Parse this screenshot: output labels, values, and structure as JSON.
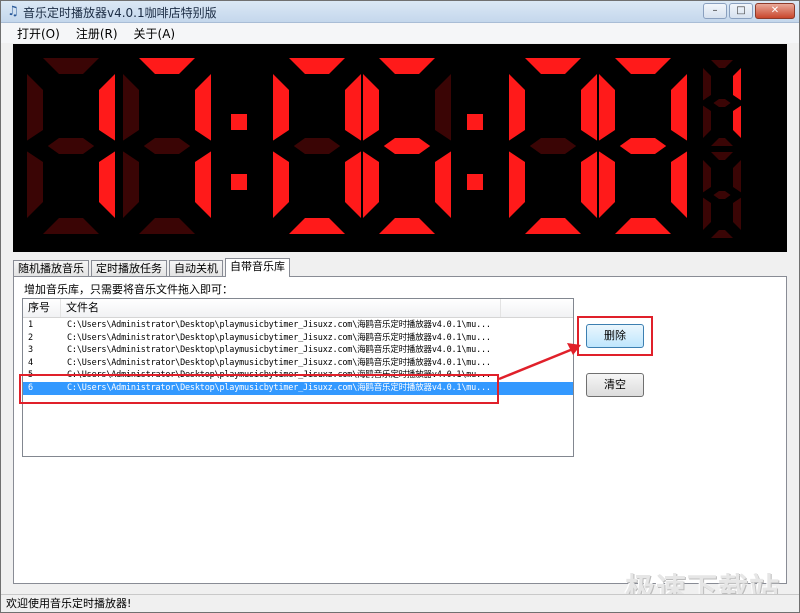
{
  "window": {
    "title": "音乐定时播放器v4.0.1咖啡店特别版",
    "app_icon": "music-note-icon",
    "controls": [
      "minimize-icon",
      "maximize-icon",
      "close-icon"
    ]
  },
  "menu": {
    "items": [
      "打开(O)",
      "注册(R)",
      "关于(A)"
    ]
  },
  "clock": {
    "time": "17:06:08",
    "seconds_small": "1",
    "segment_on_color": "#ff1a1a",
    "segment_off_color": "#3a0505"
  },
  "tabs": [
    {
      "label": "随机播放音乐",
      "active": false
    },
    {
      "label": "定时播放任务",
      "active": false
    },
    {
      "label": "自动关机",
      "active": false
    },
    {
      "label": "自带音乐库",
      "active": true
    }
  ],
  "library": {
    "hint": "增加音乐库，只需要将音乐文件拖入即可：",
    "columns": [
      "序号",
      "文件名"
    ],
    "rows": [
      {
        "index": "1",
        "path": "C:\\Users\\Administrator\\Desktop\\playmusicbytimer_Jisuxz.com\\海鸥音乐定时播放器v4.0.1\\mu..."
      },
      {
        "index": "2",
        "path": "C:\\Users\\Administrator\\Desktop\\playmusicbytimer_Jisuxz.com\\海鸥音乐定时播放器v4.0.1\\mu..."
      },
      {
        "index": "3",
        "path": "C:\\Users\\Administrator\\Desktop\\playmusicbytimer_Jisuxz.com\\海鸥音乐定时播放器v4.0.1\\mu..."
      },
      {
        "index": "4",
        "path": "C:\\Users\\Administrator\\Desktop\\playmusicbytimer_Jisuxz.com\\海鸥音乐定时播放器v4.0.1\\mu..."
      },
      {
        "index": "5",
        "path": "C:\\Users\\Administrator\\Desktop\\playmusicbytimer_Jisuxz.com\\海鸥音乐定时播放器v4.0.1\\mu..."
      },
      {
        "index": "6",
        "path": "C:\\Users\\Administrator\\Desktop\\playmusicbytimer_Jisuxz.com\\海鸥音乐定时播放器v4.0.1\\mu...",
        "selected": true
      }
    ],
    "delete_label": "删除",
    "clear_label": "清空"
  },
  "annotation_color": "#e0202a",
  "watermark": "极速下载站",
  "status": "欢迎使用音乐定时播放器!"
}
